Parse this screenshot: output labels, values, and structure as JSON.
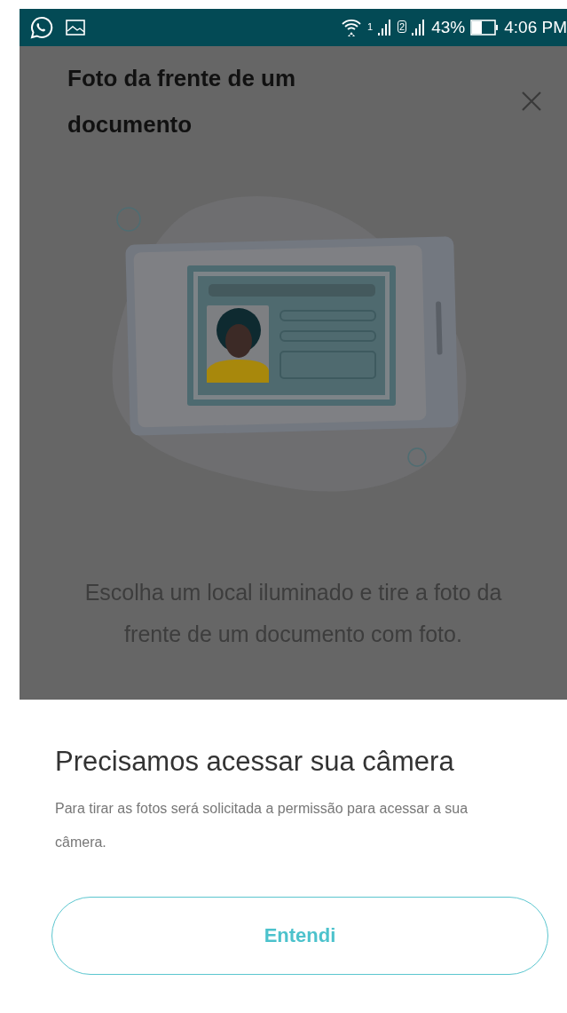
{
  "status_bar": {
    "sim_1": "1",
    "sim_2": "2",
    "battery": "43%",
    "time": "4:06 PM"
  },
  "screen": {
    "title": "Foto da frente de um documento",
    "instructions": "Escolha um local iluminado e tire a foto da frente de um documento com foto."
  },
  "dialog": {
    "title": "Precisamos acessar sua câmera",
    "message": "Para tirar as fotos será solicitada a permissão para acessar a sua câmera.",
    "button": "Entendi"
  }
}
